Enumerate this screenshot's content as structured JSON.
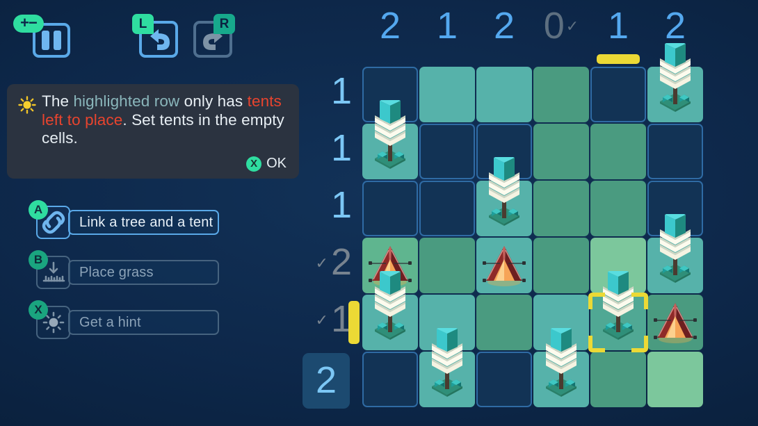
{
  "toolbar": {
    "pause": {
      "name": "pause-button",
      "badge": "+−"
    },
    "undo": {
      "key": "L",
      "label": "undo"
    },
    "redo": {
      "key": "R",
      "label": "redo"
    }
  },
  "hint": {
    "icon": "sun-icon",
    "segments": [
      {
        "text": "The ",
        "style": "plain"
      },
      {
        "text": "highlighted row",
        "style": "row"
      },
      {
        "text": " only has ",
        "style": "plain"
      },
      {
        "text": "tents left to place",
        "style": "tent"
      },
      {
        "text": ". Set tents in the empty cells.",
        "style": "plain"
      }
    ],
    "full_text": "The highlighted row only has tents left to place. Set tents in the empty cells.",
    "confirm_key": "X",
    "confirm_label": "OK"
  },
  "actions": [
    {
      "key": "A",
      "label": "Link a tree and a tent",
      "icon": "link-icon",
      "enabled": true
    },
    {
      "key": "B",
      "label": "Place grass",
      "icon": "grass-ruler-icon",
      "enabled": false
    },
    {
      "key": "X",
      "label": "Get a hint",
      "icon": "hint-sun-icon",
      "enabled": false
    }
  ],
  "board": {
    "columns": 6,
    "rows": 6,
    "col_clues": [
      {
        "value": "2",
        "done": false
      },
      {
        "value": "1",
        "done": false
      },
      {
        "value": "2",
        "done": false
      },
      {
        "value": "0",
        "done": true
      },
      {
        "value": "1",
        "done": false
      },
      {
        "value": "2",
        "done": false
      }
    ],
    "row_clues": [
      {
        "value": "1",
        "done": false,
        "boxed": false
      },
      {
        "value": "1",
        "done": false,
        "boxed": false
      },
      {
        "value": "1",
        "done": false,
        "boxed": false
      },
      {
        "value": "2",
        "done": true,
        "boxed": false
      },
      {
        "value": "1",
        "done": true,
        "boxed": false
      },
      {
        "value": "2",
        "done": false,
        "boxed": true
      }
    ],
    "highlighted_column": 5,
    "highlighted_row": 5,
    "cursor": {
      "row": 5,
      "col": 5
    },
    "cells": [
      [
        {
          "t": "empty"
        },
        {
          "t": "grass",
          "s": "g1"
        },
        {
          "t": "grass",
          "s": "g1"
        },
        {
          "t": "grass",
          "s": "g2"
        },
        {
          "t": "empty"
        },
        {
          "t": "tree",
          "s": "g1"
        }
      ],
      [
        {
          "t": "tree",
          "s": "g1"
        },
        {
          "t": "empty"
        },
        {
          "t": "empty"
        },
        {
          "t": "grass",
          "s": "g2"
        },
        {
          "t": "grass",
          "s": "g2"
        },
        {
          "t": "empty"
        }
      ],
      [
        {
          "t": "empty"
        },
        {
          "t": "empty"
        },
        {
          "t": "tree",
          "s": "g1"
        },
        {
          "t": "grass",
          "s": "g2"
        },
        {
          "t": "grass",
          "s": "g2"
        },
        {
          "t": "empty"
        }
      ],
      [
        {
          "t": "tent",
          "s": "g3"
        },
        {
          "t": "grass",
          "s": "g2"
        },
        {
          "t": "tent",
          "s": "g1"
        },
        {
          "t": "grass",
          "s": "g2"
        },
        {
          "t": "grass",
          "s": "g4"
        },
        {
          "t": "tree",
          "s": "g1"
        }
      ],
      [
        {
          "t": "tree",
          "s": "g1"
        },
        {
          "t": "grass",
          "s": "g1"
        },
        {
          "t": "grass",
          "s": "g2"
        },
        {
          "t": "grass",
          "s": "g1"
        },
        {
          "t": "tree",
          "s": "g5"
        },
        {
          "t": "tent",
          "s": "g2"
        }
      ],
      [
        {
          "t": "empty"
        },
        {
          "t": "tree",
          "s": "g1"
        },
        {
          "t": "empty"
        },
        {
          "t": "tree",
          "s": "g1"
        },
        {
          "t": "grass",
          "s": "g2"
        },
        {
          "t": "grass",
          "s": "g4"
        }
      ]
    ]
  },
  "colors": {
    "accent_green": "#2fdda0",
    "clue_blue": "#54a8ef",
    "highlight_yellow": "#ecd935",
    "tent_red": "#b03030",
    "tree_teal": "#3fc0c0",
    "background": "#0d2749"
  }
}
